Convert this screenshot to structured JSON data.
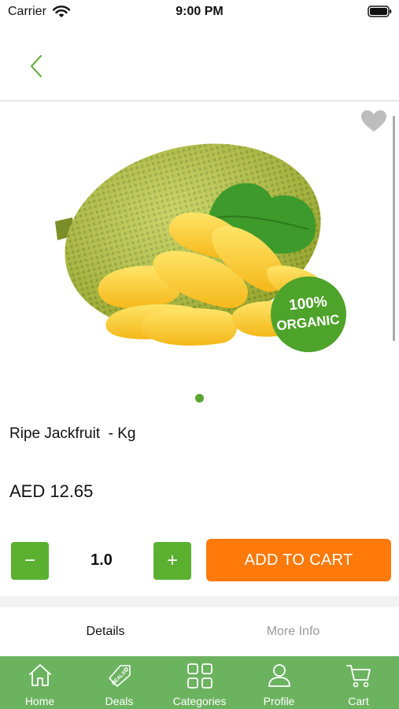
{
  "status_bar": {
    "carrier": "Carrier",
    "time": "9:00 PM"
  },
  "product": {
    "name": "Ripe Jackfruit  - Kg",
    "price": "AED 12.65",
    "badge_text": "100% ORGANIC",
    "quantity": "1.0",
    "current_image": 1,
    "image_count": 1
  },
  "actions": {
    "minus_label": "−",
    "plus_label": "+",
    "add_to_cart": "ADD TO CART"
  },
  "tabs": [
    {
      "label": "Details"
    },
    {
      "label": "More Info"
    }
  ],
  "bottom_nav": [
    {
      "label": "Home",
      "icon": "home-icon"
    },
    {
      "label": "Deals",
      "icon": "deals-tag-icon"
    },
    {
      "label": "Categories",
      "icon": "grid-icon"
    },
    {
      "label": "Profile",
      "icon": "person-icon"
    },
    {
      "label": "Cart",
      "icon": "cart-icon"
    }
  ],
  "colors": {
    "brand_green": "#5bb12f",
    "nav_green": "#6cb360",
    "accent_orange": "#ff7a0a"
  }
}
